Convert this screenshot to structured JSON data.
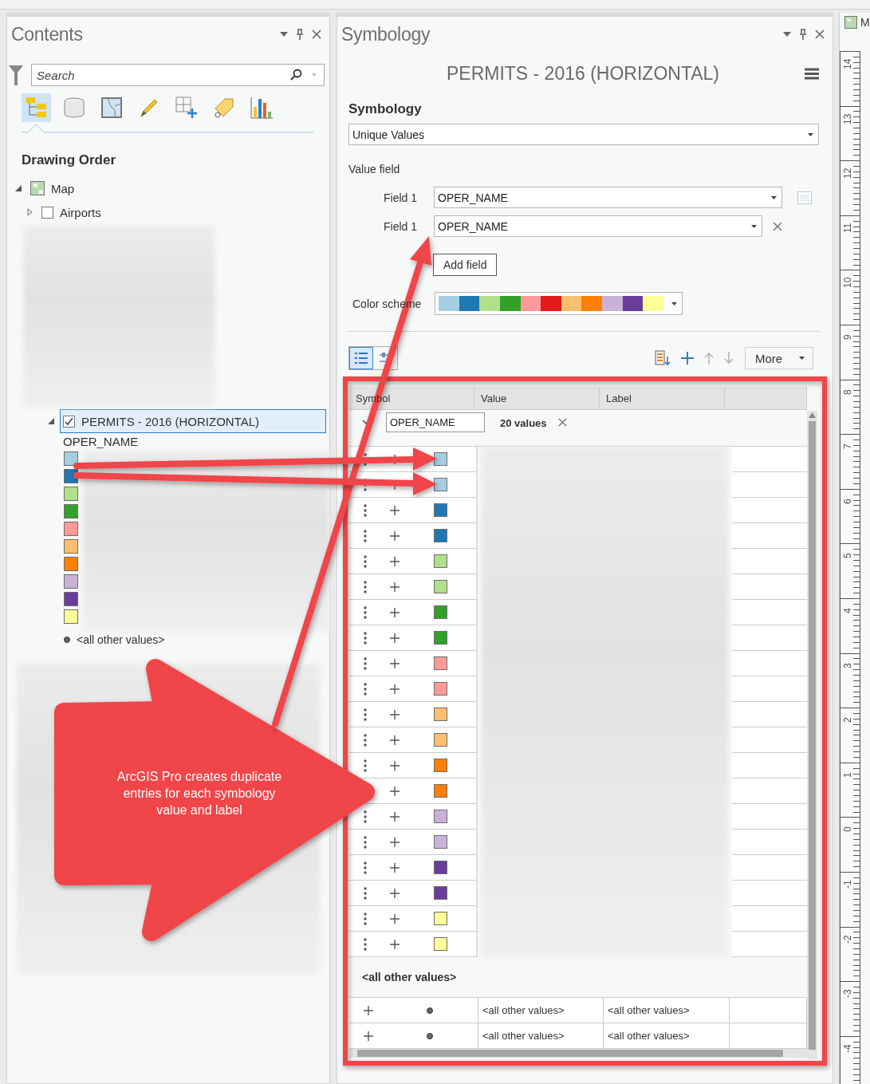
{
  "contents": {
    "title": "Contents",
    "search": {
      "placeholder": "Search"
    },
    "views": [
      {
        "kind": "tree",
        "selected": true
      },
      {
        "kind": "source",
        "selected": false
      },
      {
        "kind": "selection",
        "selected": false
      },
      {
        "kind": "edit",
        "selected": false
      },
      {
        "kind": "snap",
        "selected": false
      },
      {
        "kind": "label",
        "selected": false
      },
      {
        "kind": "chart",
        "selected": false
      }
    ],
    "heading": "Drawing Order",
    "tree": [
      {
        "kind": "map",
        "label": "Map",
        "expanded": true,
        "selected": false,
        "children": [
          {
            "kind": "layer",
            "label": "Airports",
            "checked": false,
            "expanded": false,
            "selected": false
          },
          {
            "kind": "blurred",
            "children": [
              {
                "kind": "layer",
                "label": "PERMITS - 2016 (HORIZONTAL)",
                "checked": true,
                "expanded": true,
                "selected": true,
                "legend": {
                  "field": "OPER_NAME",
                  "classes": [
                    {
                      "color": "#a6cee3"
                    },
                    {
                      "color": "#1f78b4"
                    },
                    {
                      "color": "#b2df8a"
                    },
                    {
                      "color": "#33a02c"
                    },
                    {
                      "color": "#fb9a99"
                    },
                    {
                      "color": "#fdbf6f"
                    },
                    {
                      "color": "#ff7f00"
                    },
                    {
                      "color": "#cab2d6"
                    },
                    {
                      "color": "#6a3d9a"
                    },
                    {
                      "color": "#ffff99"
                    }
                  ],
                  "other": "<all other values>"
                }
              }
            ]
          },
          {
            "kind": "blurred"
          }
        ]
      }
    ]
  },
  "symbology": {
    "title": "Symbology",
    "layer": "PERMITS - 2016 (HORIZONTAL)",
    "section": "Symbology",
    "method": "Unique Values",
    "value_field_label": "Value field",
    "fields": [
      {
        "kind": "list",
        "label": "Field 1",
        "value": "OPER_NAME"
      },
      {
        "kind": "remove",
        "label": "Field 1",
        "value": "OPER_NAME"
      }
    ],
    "add_field": "Add field",
    "color_scheme": {
      "label": "Color scheme",
      "swatches": [
        {
          "color": "#a6cee3"
        },
        {
          "color": "#1f78b4"
        },
        {
          "color": "#b2df8a"
        },
        {
          "color": "#33a02c"
        },
        {
          "color": "#fb9a99"
        },
        {
          "color": "#e31a1c"
        },
        {
          "color": "#fdbf6f"
        },
        {
          "color": "#ff7f00"
        },
        {
          "color": "#cab2d6"
        },
        {
          "color": "#6a3d9a"
        },
        {
          "color": "#ffff99"
        }
      ]
    },
    "table_views": [
      {
        "kind": "list",
        "selected": true
      },
      {
        "kind": "detail",
        "selected": false
      }
    ],
    "more": "More",
    "table": {
      "columns": [
        "Symbol",
        "Value",
        "Label"
      ],
      "group": {
        "field": "OPER_NAME",
        "count": "20 values"
      },
      "rows": [
        {
          "color": "#a6cee3"
        },
        {
          "color": "#a6cee3"
        },
        {
          "color": "#1f78b4"
        },
        {
          "color": "#1f78b4"
        },
        {
          "color": "#b2df8a"
        },
        {
          "color": "#b2df8a"
        },
        {
          "color": "#33a02c"
        },
        {
          "color": "#33a02c"
        },
        {
          "color": "#fb9a99"
        },
        {
          "color": "#fb9a99"
        },
        {
          "color": "#fdbf6f"
        },
        {
          "color": "#fdbf6f"
        },
        {
          "color": "#ff7f00"
        },
        {
          "color": "#ff7f00"
        },
        {
          "color": "#cab2d6"
        },
        {
          "color": "#cab2d6"
        },
        {
          "color": "#6a3d9a"
        },
        {
          "color": "#6a3d9a"
        },
        {
          "color": "#ffff99"
        },
        {
          "color": "#ffff99"
        }
      ],
      "other_heading": "<all other values>",
      "other_rows": [
        {
          "value": "<all other values>",
          "label": "<all other values>"
        },
        {
          "value": "<all other values>",
          "label": "<all other values>"
        }
      ]
    }
  },
  "map_view": {
    "tab": "M",
    "ruler": [
      "14",
      "13",
      "12",
      "11",
      "10",
      "9",
      "8",
      "7",
      "6",
      "5",
      "4",
      "3",
      "2",
      "1",
      "0",
      "-1",
      "-2",
      "-3",
      "-4"
    ]
  },
  "annotation": {
    "text": "ArcGIS Pro creates duplicate entries for each symbology value and label"
  }
}
